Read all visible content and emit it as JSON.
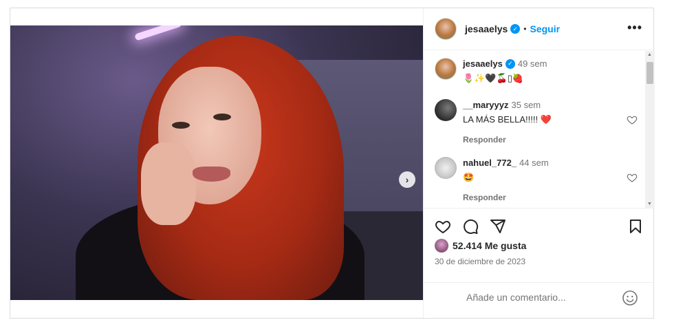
{
  "post": {
    "author": {
      "username": "jesaaelys",
      "verified_icon": "verified-badge-icon",
      "follow_label": "Seguir",
      "separator": "•"
    },
    "more_icon": "more-options-icon",
    "more_label": "•••",
    "caption": {
      "username": "jesaaelys",
      "time": "49 sem",
      "text": "🌷✨🖤🍒▯🍓"
    },
    "comments": [
      {
        "username": "__maryyyz",
        "time": "35 sem",
        "text": "LA MÁS BELLA!!!!! ❤️",
        "reply_label": "Responder"
      },
      {
        "username": "nahuel_772_",
        "time": "44 sem",
        "text": "🤩",
        "reply_label": "Responder"
      }
    ],
    "actions": {
      "like_icon": "heart-icon",
      "comment_icon": "comment-icon",
      "share_icon": "share-icon",
      "save_icon": "bookmark-icon"
    },
    "likes_label": "52.414 Me gusta",
    "date": "30 de diciembre de 2023",
    "add_comment": {
      "placeholder": "Añade un comentario...",
      "emoji_icon": "emoji-icon"
    },
    "carousel": {
      "slides": 4,
      "active_index": 0,
      "next_label": "›"
    }
  },
  "colors": {
    "accent": "#0095f6",
    "border": "#dbdbdb",
    "secondary_text": "#737373",
    "heart_red": "#ed1c24"
  }
}
